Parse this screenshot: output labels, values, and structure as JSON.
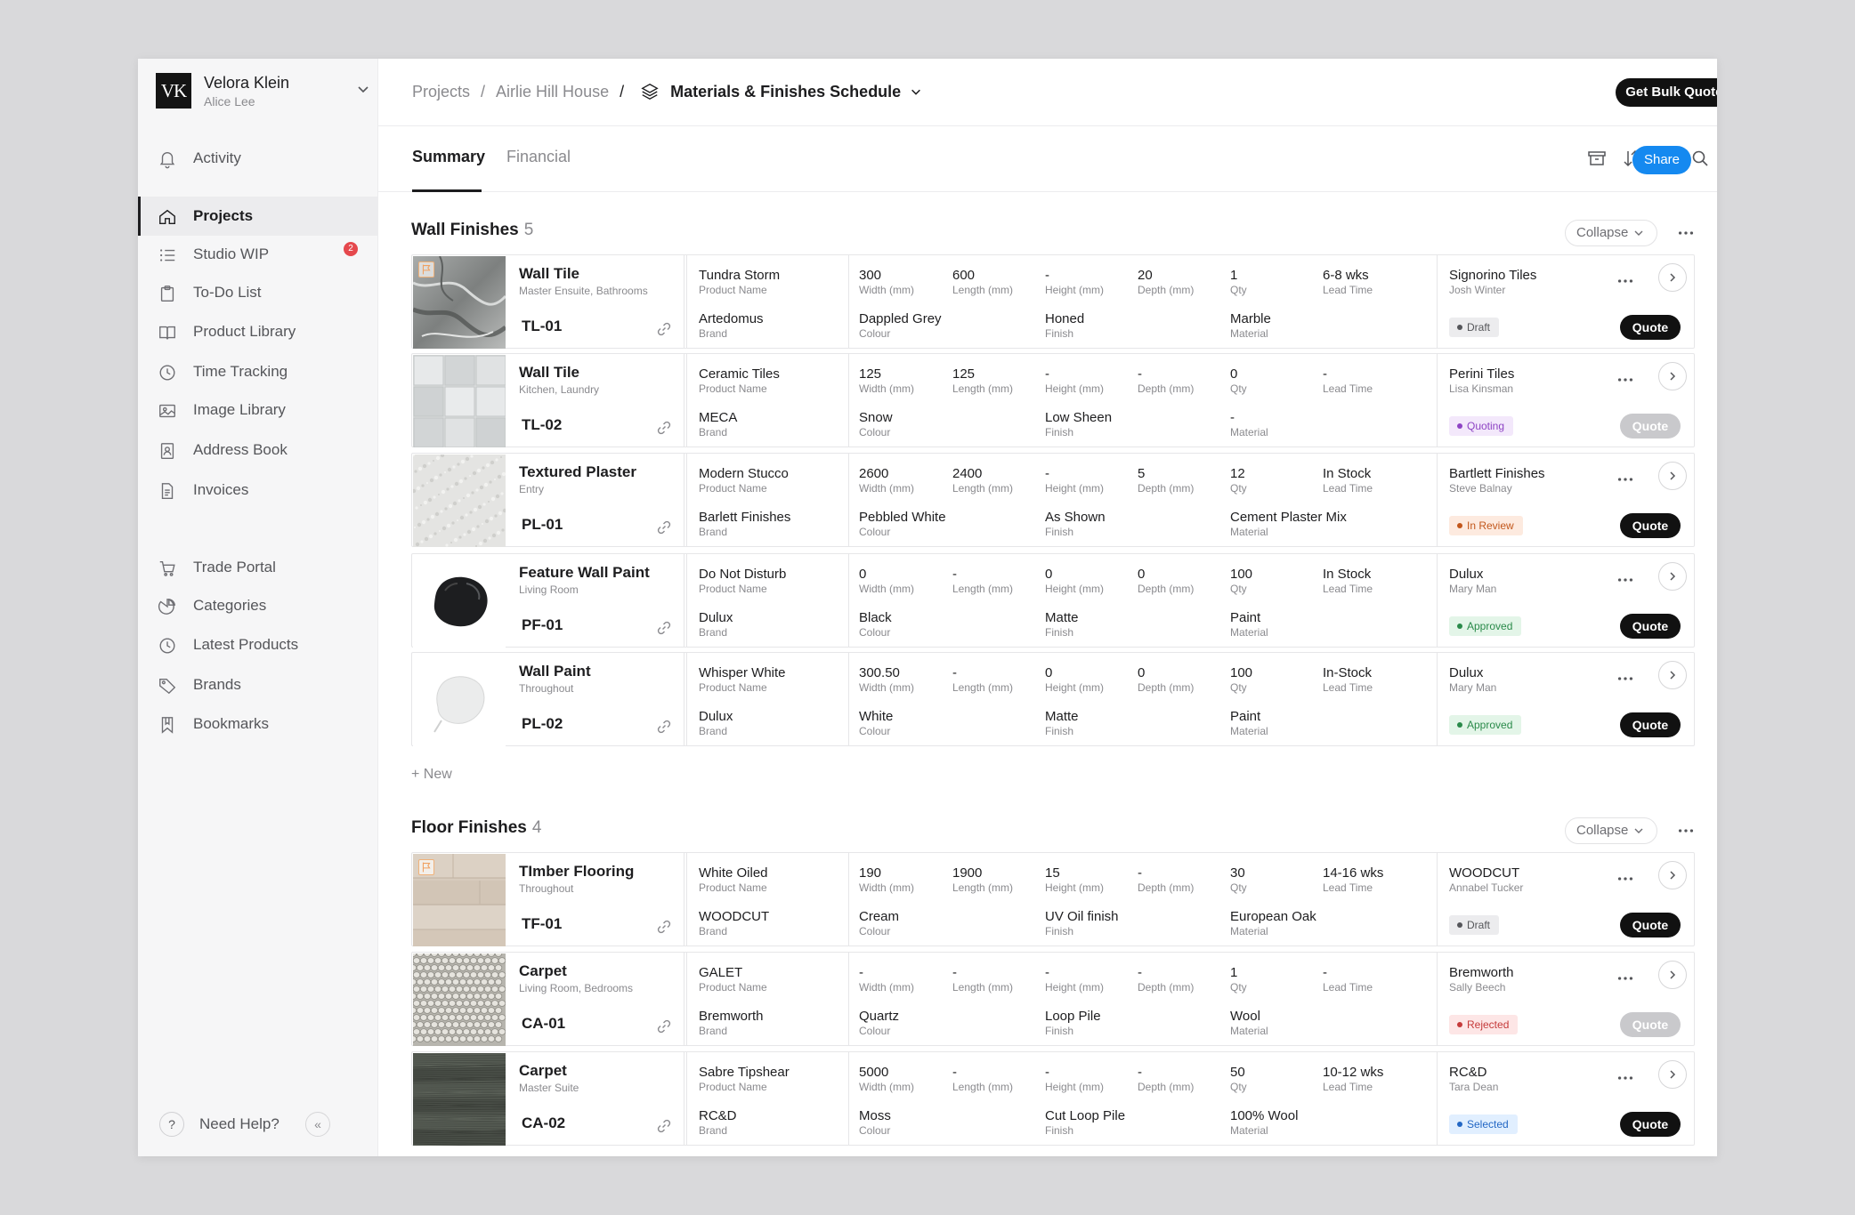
{
  "workspace": {
    "initials": "VK",
    "name": "Velora Klein",
    "user": "Alice Lee"
  },
  "sidebar": {
    "items": [
      {
        "label": "Activity",
        "icon": "bell-icon"
      },
      {
        "label": "Projects",
        "icon": "home-icon",
        "active": true
      },
      {
        "label": "Studio WIP",
        "icon": "list-icon",
        "badge": "2"
      },
      {
        "label": "To-Do List",
        "icon": "clipboard-icon"
      },
      {
        "label": "Product Library",
        "icon": "book-icon"
      },
      {
        "label": "Time Tracking",
        "icon": "clock-icon"
      },
      {
        "label": "Image Library",
        "icon": "image-icon"
      },
      {
        "label": "Address Book",
        "icon": "contact-book-icon"
      },
      {
        "label": "Invoices",
        "icon": "invoice-icon"
      },
      {
        "label": "Trade Portal",
        "icon": "cart-icon"
      },
      {
        "label": "Categories",
        "icon": "categories-icon"
      },
      {
        "label": "Latest Products",
        "icon": "clock-icon"
      },
      {
        "label": "Brands",
        "icon": "tag-icon"
      },
      {
        "label": "Bookmarks",
        "icon": "bookmark-icon"
      }
    ],
    "help_label": "Need Help?",
    "help_icon_text": "?",
    "collapse_icon_text": "«"
  },
  "breadcrumb": {
    "items": [
      "Projects",
      "Airlie Hill House"
    ],
    "separator": "/",
    "current": "Materials & Finishes Schedule"
  },
  "header": {
    "bulk_quotes_label": "Get Bulk Quotes"
  },
  "tabs": [
    "Summary",
    "Financial"
  ],
  "toolbar": {
    "share_label": "Share",
    "icons": [
      "archive-icon",
      "sort-icon",
      "filter-icon",
      "search-icon",
      "more-icon"
    ]
  },
  "labels": {
    "product_name": "Product Name",
    "brand": "Brand",
    "width": "Width (mm)",
    "length": "Length (mm)",
    "height": "Height (mm)",
    "depth": "Depth (mm)",
    "qty": "Qty",
    "lead_time": "Lead Time",
    "colour": "Colour",
    "finish": "Finish",
    "material": "Material",
    "quote": "Quote",
    "collapse": "Collapse",
    "new": "+ New"
  },
  "status_colors": {
    "Draft": {
      "bg": "#ececee",
      "fg": "#55565a"
    },
    "Quoting": {
      "bg": "#f3e8fb",
      "fg": "#8e44c4"
    },
    "In Review": {
      "bg": "#fdeadf",
      "fg": "#c2571b"
    },
    "Approved": {
      "bg": "#e3f5e8",
      "fg": "#2a8a4a"
    },
    "Rejected": {
      "bg": "#fde6e6",
      "fg": "#c53a3a"
    },
    "Selected": {
      "bg": "#e1efff",
      "fg": "#2367c4"
    }
  },
  "sections": [
    {
      "title": "Wall Finishes",
      "count": "5",
      "rows": [
        {
          "name": "Wall Tile",
          "location": "Master Ensuite, Bathrooms",
          "code": "TL-01",
          "flag": true,
          "product": "Tundra Storm",
          "brand": "Artedomus",
          "width": "300",
          "length": "600",
          "height": "-",
          "depth": "20",
          "qty": "1",
          "lead_time": "6-8 wks",
          "colour": "Dappled Grey",
          "finish": "Honed",
          "material": "Marble",
          "supplier": "Signorino Tiles",
          "contact": "Josh Winter",
          "status": "Draft",
          "quote_enabled": true,
          "swatch": "marble"
        },
        {
          "name": "Wall Tile",
          "location": "Kitchen, Laundry",
          "code": "TL-02",
          "flag": false,
          "product": "Ceramic Tiles",
          "brand": "MECA",
          "width": "125",
          "length": "125",
          "height": "-",
          "depth": "-",
          "qty": "0",
          "lead_time": "-",
          "colour": "Snow",
          "finish": "Low Sheen",
          "material": "-",
          "supplier": "Perini Tiles",
          "contact": "Lisa Kinsman",
          "status": "Quoting",
          "quote_enabled": false,
          "swatch": "ceramic"
        },
        {
          "name": "Textured Plaster",
          "location": "Entry",
          "code": "PL-01",
          "flag": false,
          "product": "Modern Stucco",
          "brand": "Barlett Finishes",
          "width": "2600",
          "length": "2400",
          "height": "-",
          "depth": "5",
          "qty": "12",
          "lead_time": "In Stock",
          "colour": "Pebbled White",
          "finish": "As Shown",
          "material": "Cement Plaster Mix",
          "supplier": "Bartlett Finishes",
          "contact": "Steve Balnay",
          "status": "In Review",
          "quote_enabled": true,
          "swatch": "plaster"
        },
        {
          "name": "Feature Wall Paint",
          "location": "Living Room",
          "code": "PF-01",
          "flag": false,
          "product": "Do Not Disturb",
          "brand": "Dulux",
          "width": "0",
          "length": "-",
          "height": "0",
          "depth": "0",
          "qty": "100",
          "lead_time": "In Stock",
          "colour": "Black",
          "finish": "Matte",
          "material": "Paint",
          "supplier": "Dulux",
          "contact": "Mary Man",
          "status": "Approved",
          "quote_enabled": true,
          "swatch": "paint-black"
        },
        {
          "name": "Wall Paint",
          "location": "Throughout",
          "code": "PL-02",
          "flag": false,
          "product": "Whisper White",
          "brand": "Dulux",
          "width": "300.50",
          "length": "-",
          "height": "0",
          "depth": "0",
          "qty": "100",
          "lead_time": "In-Stock",
          "colour": "White",
          "finish": "Matte",
          "material": "Paint",
          "supplier": "Dulux",
          "contact": "Mary Man",
          "status": "Approved",
          "quote_enabled": true,
          "swatch": "paint-white"
        }
      ]
    },
    {
      "title": "Floor Finishes",
      "count": "4",
      "rows": [
        {
          "name": "TImber Flooring",
          "location": "Throughout",
          "code": "TF-01",
          "flag": true,
          "product": "White Oiled",
          "brand": "WOODCUT",
          "width": "190",
          "length": "1900",
          "height": "15",
          "depth": "-",
          "qty": "30",
          "lead_time": "14-16 wks",
          "colour": "Cream",
          "finish": "UV Oil finish",
          "material": "European Oak",
          "supplier": "WOODCUT",
          "contact": "Annabel Tucker",
          "status": "Draft",
          "quote_enabled": true,
          "swatch": "timber"
        },
        {
          "name": "Carpet",
          "location": "Living Room, Bedrooms",
          "code": "CA-01",
          "flag": false,
          "product": "GALET",
          "brand": "Bremworth",
          "width": "-",
          "length": "-",
          "height": "-",
          "depth": "-",
          "qty": "1",
          "lead_time": "-",
          "colour": "Quartz",
          "finish": "Loop Pile",
          "material": "Wool",
          "supplier": "Bremworth",
          "contact": "Sally Beech",
          "status": "Rejected",
          "quote_enabled": false,
          "swatch": "loop"
        },
        {
          "name": "Carpet",
          "location": "Master Suite",
          "code": "CA-02",
          "flag": false,
          "product": "Sabre Tipshear",
          "brand": "RC&D",
          "width": "5000",
          "length": "-",
          "height": "-",
          "depth": "-",
          "qty": "50",
          "lead_time": "10-12 wks",
          "colour": "Moss",
          "finish": "Cut Loop Pile",
          "material": "100% Wool",
          "supplier": "RC&D",
          "contact": "Tara Dean",
          "status": "Selected",
          "quote_enabled": true,
          "swatch": "moss"
        }
      ]
    }
  ]
}
